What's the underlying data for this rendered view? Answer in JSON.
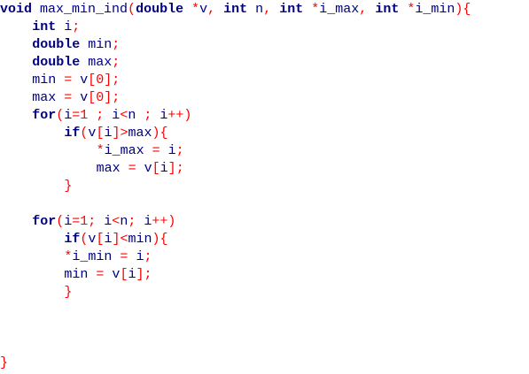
{
  "code": {
    "func_type": "void",
    "func_name": "max_min_ind",
    "lines": [
      {
        "indent": 0,
        "tokens": [
          [
            "kw",
            "void"
          ],
          [
            "id",
            " max_min_ind"
          ],
          [
            "op",
            "("
          ],
          [
            "kw",
            "double"
          ],
          [
            "id",
            " "
          ],
          [
            "op",
            "*"
          ],
          [
            "id",
            "v"
          ],
          [
            "op",
            ","
          ],
          [
            "id",
            " "
          ],
          [
            "kw",
            "int"
          ],
          [
            "id",
            " n"
          ],
          [
            "op",
            ","
          ],
          [
            "id",
            " "
          ],
          [
            "kw",
            "int"
          ],
          [
            "id",
            " "
          ],
          [
            "op",
            "*"
          ],
          [
            "id",
            "i_max"
          ],
          [
            "op",
            ","
          ],
          [
            "id",
            " "
          ],
          [
            "kw",
            "int"
          ],
          [
            "id",
            " "
          ],
          [
            "op",
            "*"
          ],
          [
            "id",
            "i_min"
          ],
          [
            "op",
            ")"
          ],
          [
            "op",
            "{"
          ]
        ]
      },
      {
        "indent": 4,
        "tokens": [
          [
            "kw",
            "int"
          ],
          [
            "id",
            " i"
          ],
          [
            "op",
            ";"
          ]
        ]
      },
      {
        "indent": 4,
        "tokens": [
          [
            "kw",
            "double"
          ],
          [
            "id",
            " min"
          ],
          [
            "op",
            ";"
          ]
        ]
      },
      {
        "indent": 4,
        "tokens": [
          [
            "kw",
            "double"
          ],
          [
            "id",
            " max"
          ],
          [
            "op",
            ";"
          ]
        ]
      },
      {
        "indent": 4,
        "tokens": [
          [
            "id",
            "min "
          ],
          [
            "op",
            "="
          ],
          [
            "id",
            " v"
          ],
          [
            "op",
            "["
          ],
          [
            "num",
            "0"
          ],
          [
            "op",
            "]"
          ],
          [
            "op",
            ";"
          ]
        ]
      },
      {
        "indent": 4,
        "tokens": [
          [
            "id",
            "max "
          ],
          [
            "op",
            "="
          ],
          [
            "id",
            " v"
          ],
          [
            "op",
            "["
          ],
          [
            "num",
            "0"
          ],
          [
            "op",
            "]"
          ],
          [
            "op",
            ";"
          ]
        ]
      },
      {
        "indent": 4,
        "tokens": [
          [
            "kw",
            "for"
          ],
          [
            "op",
            "("
          ],
          [
            "id",
            "i"
          ],
          [
            "op",
            "="
          ],
          [
            "num",
            "1"
          ],
          [
            "id",
            " "
          ],
          [
            "op",
            ";"
          ],
          [
            "id",
            " i"
          ],
          [
            "op",
            "<"
          ],
          [
            "id",
            "n "
          ],
          [
            "op",
            ";"
          ],
          [
            "id",
            " i"
          ],
          [
            "op",
            "++"
          ],
          [
            "op",
            ")"
          ]
        ]
      },
      {
        "indent": 8,
        "tokens": [
          [
            "kw",
            "if"
          ],
          [
            "op",
            "("
          ],
          [
            "id",
            "v"
          ],
          [
            "op",
            "["
          ],
          [
            "id",
            "i"
          ],
          [
            "op",
            "]"
          ],
          [
            "op",
            ">"
          ],
          [
            "id",
            "max"
          ],
          [
            "op",
            ")"
          ],
          [
            "op",
            "{"
          ]
        ]
      },
      {
        "indent": 12,
        "tokens": [
          [
            "op",
            "*"
          ],
          [
            "id",
            "i_max "
          ],
          [
            "op",
            "="
          ],
          [
            "id",
            " i"
          ],
          [
            "op",
            ";"
          ]
        ]
      },
      {
        "indent": 12,
        "tokens": [
          [
            "id",
            "max "
          ],
          [
            "op",
            "="
          ],
          [
            "id",
            " v"
          ],
          [
            "op",
            "["
          ],
          [
            "id",
            "i"
          ],
          [
            "op",
            "]"
          ],
          [
            "op",
            ";"
          ]
        ]
      },
      {
        "indent": 8,
        "tokens": [
          [
            "op",
            "}"
          ]
        ]
      },
      {
        "indent": 0,
        "tokens": []
      },
      {
        "indent": 4,
        "tokens": [
          [
            "kw",
            "for"
          ],
          [
            "op",
            "("
          ],
          [
            "id",
            "i"
          ],
          [
            "op",
            "="
          ],
          [
            "num",
            "1"
          ],
          [
            "op",
            ";"
          ],
          [
            "id",
            " i"
          ],
          [
            "op",
            "<"
          ],
          [
            "id",
            "n"
          ],
          [
            "op",
            ";"
          ],
          [
            "id",
            " i"
          ],
          [
            "op",
            "++"
          ],
          [
            "op",
            ")"
          ]
        ]
      },
      {
        "indent": 8,
        "tokens": [
          [
            "kw",
            "if"
          ],
          [
            "op",
            "("
          ],
          [
            "id",
            "v"
          ],
          [
            "op",
            "["
          ],
          [
            "id",
            "i"
          ],
          [
            "op",
            "]"
          ],
          [
            "op",
            "<"
          ],
          [
            "id",
            "min"
          ],
          [
            "op",
            ")"
          ],
          [
            "op",
            "{"
          ]
        ]
      },
      {
        "indent": 8,
        "tokens": [
          [
            "op",
            "*"
          ],
          [
            "id",
            "i_min "
          ],
          [
            "op",
            "="
          ],
          [
            "id",
            " i"
          ],
          [
            "op",
            ";"
          ]
        ]
      },
      {
        "indent": 8,
        "tokens": [
          [
            "id",
            "min "
          ],
          [
            "op",
            "="
          ],
          [
            "id",
            " v"
          ],
          [
            "op",
            "["
          ],
          [
            "id",
            "i"
          ],
          [
            "op",
            "]"
          ],
          [
            "op",
            ";"
          ]
        ]
      },
      {
        "indent": 8,
        "tokens": [
          [
            "op",
            "}"
          ]
        ]
      },
      {
        "indent": 0,
        "tokens": []
      },
      {
        "indent": 0,
        "tokens": []
      },
      {
        "indent": 0,
        "tokens": []
      },
      {
        "indent": 0,
        "tokens": [
          [
            "op",
            "}"
          ]
        ]
      }
    ]
  },
  "colors": {
    "keyword": "#000080",
    "identifier": "#000080",
    "operator": "#ff0000",
    "number": "#ff0000",
    "background": "#ffffff"
  }
}
